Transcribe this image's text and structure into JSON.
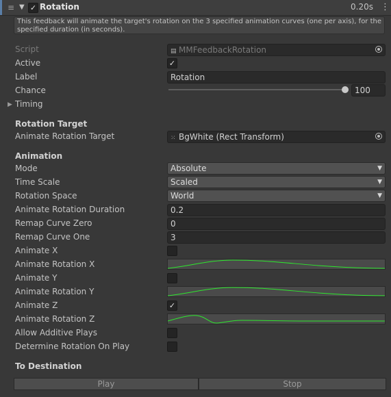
{
  "header": {
    "title": "Rotation",
    "duration": "0.20s",
    "active": true,
    "menu_glyph": "⋮"
  },
  "help_text": "This feedback will animate the target's rotation on the 3 specified animation curves (one per axis), for the specified duration (in seconds).",
  "script": {
    "label": "Script",
    "value": "MMFeedbackRotation"
  },
  "active": {
    "label": "Active",
    "checked": true
  },
  "label_field": {
    "label": "Label",
    "value": "Rotation"
  },
  "chance": {
    "label": "Chance",
    "value": "100",
    "fraction": 1.0
  },
  "timing": {
    "label": "Timing"
  },
  "rotation_target": {
    "section": "Rotation Target",
    "label": "Animate Rotation Target",
    "value": "BgWhite (Rect Transform)"
  },
  "animation": {
    "section": "Animation",
    "mode": {
      "label": "Mode",
      "value": "Absolute"
    },
    "time_scale": {
      "label": "Time Scale",
      "value": "Scaled"
    },
    "rotation_space": {
      "label": "Rotation Space",
      "value": "World"
    },
    "duration": {
      "label": "Animate Rotation Duration",
      "value": "0.2"
    },
    "remap_zero": {
      "label": "Remap Curve Zero",
      "value": "0"
    },
    "remap_one": {
      "label": "Remap Curve One",
      "value": "3"
    },
    "animate_x": {
      "label": "Animate X",
      "checked": false
    },
    "rotation_x": {
      "label": "Animate Rotation X"
    },
    "animate_y": {
      "label": "Animate Y",
      "checked": false
    },
    "rotation_y": {
      "label": "Animate Rotation Y"
    },
    "animate_z": {
      "label": "Animate Z",
      "checked": true
    },
    "rotation_z": {
      "label": "Animate Rotation Z"
    },
    "allow_additive": {
      "label": "Allow Additive Plays",
      "checked": false
    },
    "determine_on_play": {
      "label": "Determine Rotation On Play",
      "checked": false
    }
  },
  "to_destination": {
    "section": "To Destination"
  },
  "buttons": {
    "play": "Play",
    "stop": "Stop"
  },
  "colors": {
    "curve": "#2ee82e",
    "accent_bar": "#5a7fa8"
  }
}
